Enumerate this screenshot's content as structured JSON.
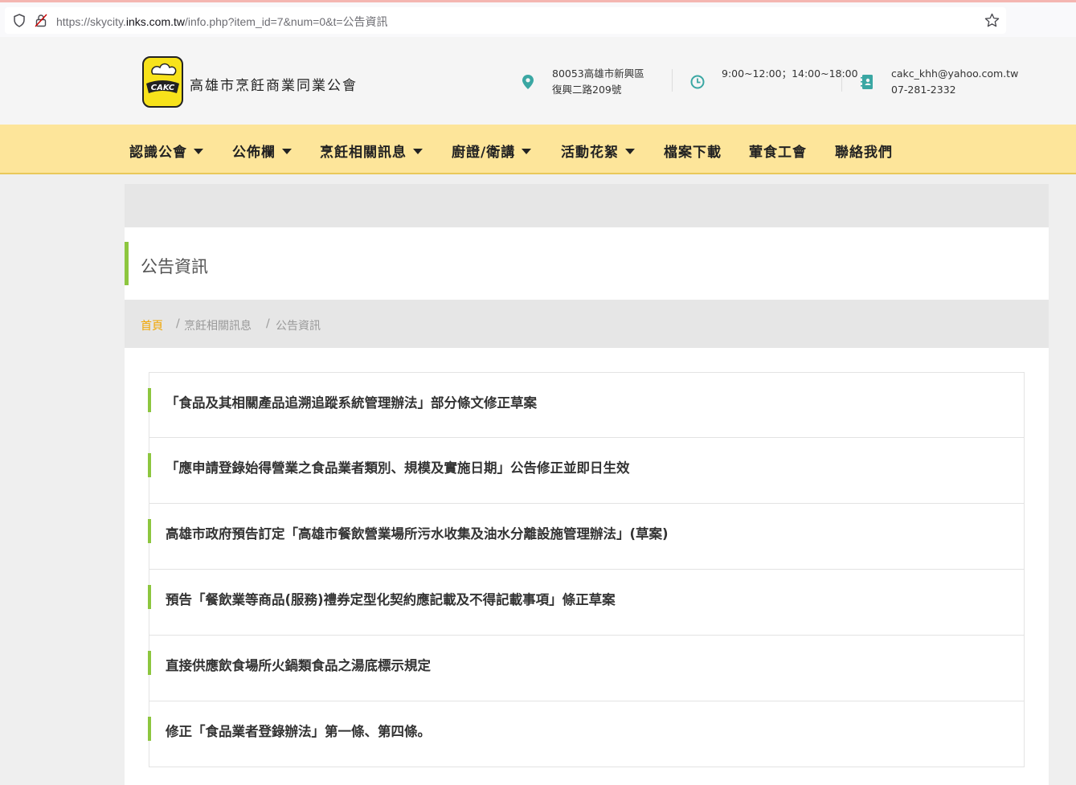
{
  "browser": {
    "url_prefix": "https://skycity.",
    "url_domain": "inks.com.tw",
    "url_path": "/info.php?item_id=7&num=0&t=公告資訊"
  },
  "header": {
    "site_title": "高雄市烹飪商業同業公會",
    "logo_text": "CAKC",
    "address_line1": "80053高雄市新興區",
    "address_line2": "復興二路209號",
    "hours": "9:00~12:00；14:00~18:00",
    "email": "cakc_khh@yahoo.com.tw",
    "phone": "07-281-2332"
  },
  "nav": {
    "items": [
      {
        "label": "認識公會",
        "dropdown": true
      },
      {
        "label": "公佈欄",
        "dropdown": true
      },
      {
        "label": "烹飪相關訊息",
        "dropdown": true
      },
      {
        "label": "廚證/衛講",
        "dropdown": true
      },
      {
        "label": "活動花絮",
        "dropdown": true
      },
      {
        "label": "檔案下載",
        "dropdown": false
      },
      {
        "label": "葷食工會",
        "dropdown": false
      },
      {
        "label": "聯絡我們",
        "dropdown": false
      }
    ]
  },
  "page": {
    "title": "公告資訊",
    "breadcrumb": [
      "首頁",
      "烹飪相關訊息",
      "公告資訊"
    ],
    "breadcrumb_sep": "/"
  },
  "news": [
    "「食品及其相關產品追溯追蹤系統管理辦法」部分條文修正草案",
    "「應申請登錄始得營業之食品業者類別、規模及實施日期」公告修正並即日生效",
    "高雄市政府預告訂定「高雄市餐飲營業場所污水收集及油水分離設施管理辦法」(草案)",
    "預告「餐飲業等商品(服務)禮券定型化契約應記載及不得記載事項」條正草案",
    "直接供應飲食場所火鍋類食品之湯底標示規定",
    "修正「食品業者登錄辦法」第一條、第四條。"
  ],
  "colors": {
    "nav_bg": "#fde59a",
    "accent_green": "#8dc63f",
    "breadcrumb_home": "#f0a500",
    "icon_teal": "#3aa7a3"
  }
}
